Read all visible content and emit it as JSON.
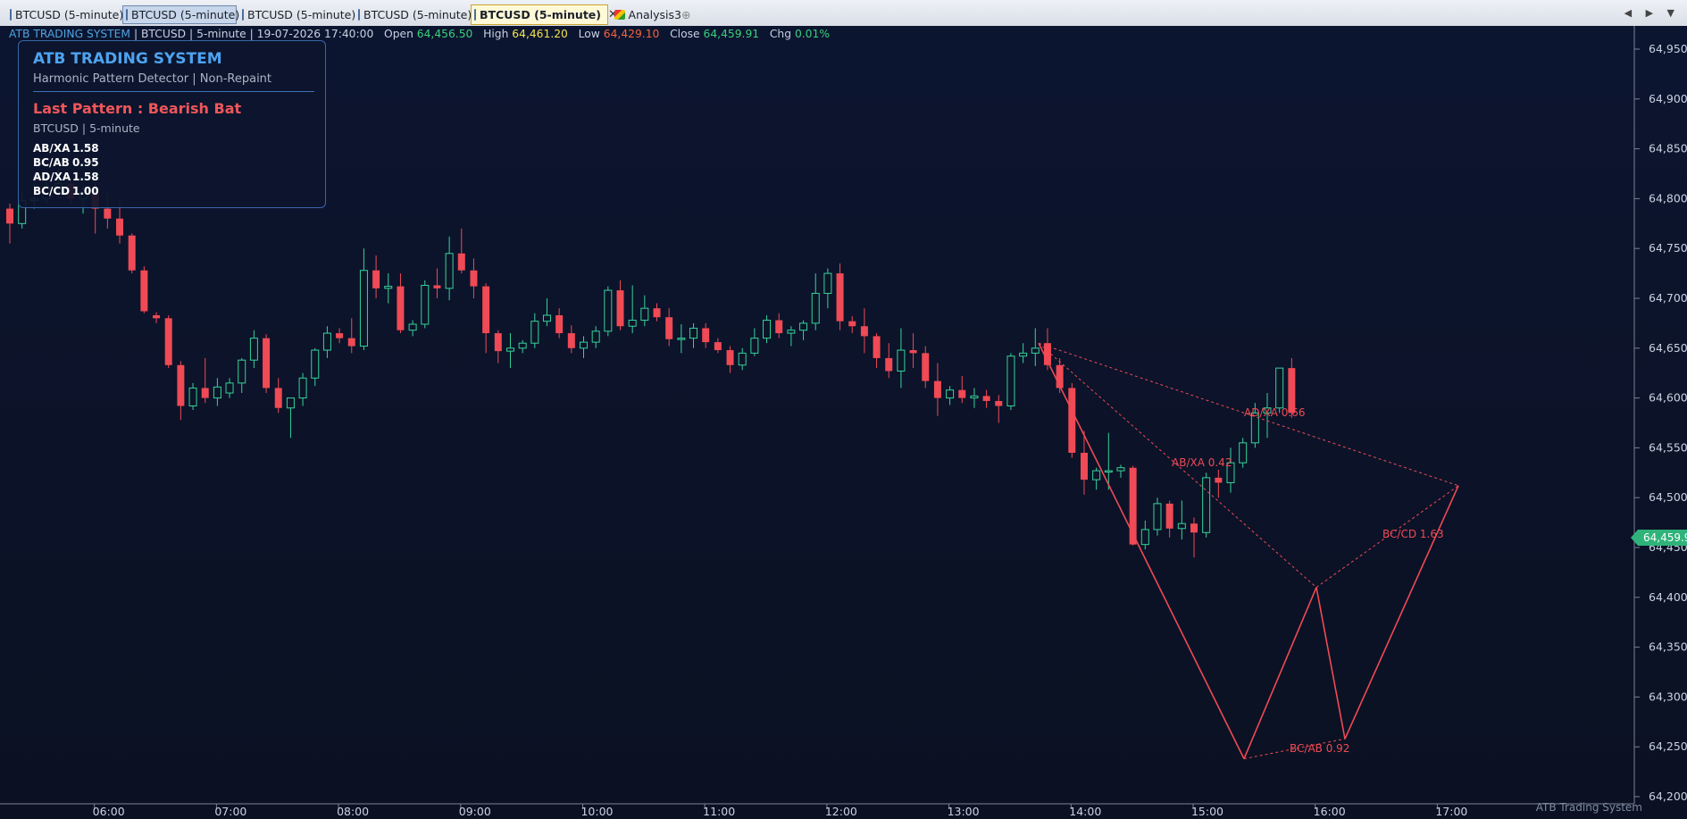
{
  "tabs": [
    {
      "label": "BTCUSD (5-minute)",
      "state": "normal"
    },
    {
      "label": "BTCUSD (5-minute)",
      "state": "selected"
    },
    {
      "label": "BTCUSD (5-minute)",
      "state": "normal"
    },
    {
      "label": "BTCUSD (5-minute)",
      "state": "normal"
    },
    {
      "label": "BTCUSD (5-minute)",
      "state": "active",
      "close": "✕"
    },
    {
      "label": "Analysis3",
      "state": "normal"
    }
  ],
  "new_tab_glyph": "⊕",
  "nav_arrows": "◀ ▶ ▼",
  "info_line": {
    "indicator": "ATB TRADING SYSTEM",
    "symbol": "BTCUSD",
    "interval": "5-minute",
    "datetime": "19-07-2026 17:40:00",
    "open_label": "Open",
    "open": "64,456.50",
    "high_label": "High",
    "high": "64,461.20",
    "low_label": "Low",
    "low": "64,429.10",
    "close_label": "Close",
    "close": "64,459.91",
    "chg_label": "Chg",
    "chg": "0.01%"
  },
  "panel": {
    "title": "ATB TRADING SYSTEM",
    "subtitle": "Harmonic Pattern Detector  |  Non-Repaint",
    "last_pattern": "Last Pattern : Bearish Bat",
    "symbol_line": "BTCUSD   |   5-minute",
    "ratios": [
      {
        "name": "AB/XA",
        "value": "1.58"
      },
      {
        "name": "BC/AB",
        "value": "0.95"
      },
      {
        "name": "AD/XA",
        "value": "1.58"
      },
      {
        "name": "BC/CD",
        "value": "1.00"
      }
    ]
  },
  "colors": {
    "background": "#0c1428",
    "bull": "#36d39a",
    "bear": "#ef4a55",
    "pattern": "#ef4a55",
    "price_tag": "#2fb37a",
    "panel_border": "#3766a8"
  },
  "chart_data": {
    "type": "candlestick",
    "y_ticks": [
      "64,950",
      "64,900",
      "64,850",
      "64,800",
      "64,750",
      "64,700",
      "64,650",
      "64,600",
      "64,550",
      "64,500",
      "64,450",
      "64,400",
      "64,350",
      "64,300",
      "64,250",
      "64,200"
    ],
    "y_tick_values": [
      64950,
      64900,
      64850,
      64800,
      64750,
      64700,
      64650,
      64600,
      64550,
      64500,
      64450,
      64400,
      64350,
      64300,
      64250,
      64200
    ],
    "x_ticks": [
      "06:00",
      "07:00",
      "08:00",
      "09:00",
      "10:00",
      "11:00",
      "12:00",
      "13:00",
      "14:00",
      "15:00",
      "16:00",
      "17:00"
    ],
    "x_tick_indices": [
      7,
      17,
      27,
      37,
      47,
      57,
      67,
      77,
      87,
      97,
      107,
      117
    ],
    "last_price": "64,459.9",
    "last_price_value": 64459.9,
    "candles_ohlc": [
      [
        64790,
        64795,
        64755,
        64775
      ],
      [
        64775,
        64808,
        64770,
        64798
      ],
      [
        64798,
        64815,
        64790,
        64800
      ],
      [
        64800,
        64825,
        64795,
        64812
      ],
      [
        64812,
        64830,
        64800,
        64815
      ],
      [
        64815,
        64820,
        64795,
        64800
      ],
      [
        64800,
        64812,
        64785,
        64805
      ],
      [
        64805,
        64815,
        64765,
        64790
      ],
      [
        64790,
        64805,
        64770,
        64780
      ],
      [
        64780,
        64800,
        64755,
        64763
      ],
      [
        64763,
        64765,
        64725,
        64728
      ],
      [
        64728,
        64732,
        64685,
        64687
      ],
      [
        64683,
        64686,
        64675,
        64680
      ],
      [
        64680,
        64683,
        64630,
        64633
      ],
      [
        64633,
        64637,
        64578,
        64592
      ],
      [
        64592,
        64615,
        64588,
        64610
      ],
      [
        64610,
        64640,
        64595,
        64600
      ],
      [
        64600,
        64620,
        64592,
        64611
      ],
      [
        64605,
        64620,
        64600,
        64615
      ],
      [
        64615,
        64640,
        64605,
        64638
      ],
      [
        64638,
        64668,
        64630,
        64660
      ],
      [
        64660,
        64664,
        64605,
        64610
      ],
      [
        64610,
        64620,
        64585,
        64590
      ],
      [
        64590,
        64598,
        64560,
        64600
      ],
      [
        64600,
        64625,
        64592,
        64620
      ],
      [
        64620,
        64650,
        64612,
        64648
      ],
      [
        64648,
        64672,
        64640,
        64665
      ],
      [
        64665,
        64670,
        64655,
        64660
      ],
      [
        64660,
        64680,
        64645,
        64652
      ],
      [
        64652,
        64750,
        64648,
        64728
      ],
      [
        64728,
        64743,
        64700,
        64710
      ],
      [
        64710,
        64725,
        64695,
        64712
      ],
      [
        64712,
        64725,
        64665,
        64668
      ],
      [
        64668,
        64678,
        64662,
        64674
      ],
      [
        64674,
        64718,
        64670,
        64713
      ],
      [
        64713,
        64730,
        64700,
        64710
      ],
      [
        64710,
        64762,
        64698,
        64745
      ],
      [
        64745,
        64770,
        64725,
        64728
      ],
      [
        64728,
        64740,
        64700,
        64712
      ],
      [
        64712,
        64715,
        64645,
        64665
      ],
      [
        64665,
        64668,
        64635,
        64647
      ],
      [
        64647,
        64665,
        64630,
        64650
      ],
      [
        64650,
        64658,
        64645,
        64655
      ],
      [
        64655,
        64685,
        64650,
        64677
      ],
      [
        64677,
        64700,
        64672,
        64683
      ],
      [
        64683,
        64690,
        64660,
        64665
      ],
      [
        64665,
        64673,
        64645,
        64650
      ],
      [
        64650,
        64662,
        64640,
        64656
      ],
      [
        64656,
        64672,
        64650,
        64667
      ],
      [
        64667,
        64712,
        64662,
        64708
      ],
      [
        64708,
        64718,
        64668,
        64672
      ],
      [
        64672,
        64713,
        64665,
        64678
      ],
      [
        64678,
        64703,
        64672,
        64690
      ],
      [
        64690,
        64695,
        64677,
        64681
      ],
      [
        64681,
        64690,
        64652,
        64659
      ],
      [
        64659,
        64674,
        64645,
        64660
      ],
      [
        64660,
        64675,
        64650,
        64670
      ],
      [
        64670,
        64675,
        64650,
        64656
      ],
      [
        64656,
        64660,
        64645,
        64648
      ],
      [
        64648,
        64652,
        64625,
        64633
      ],
      [
        64633,
        64650,
        64628,
        64645
      ],
      [
        64645,
        64670,
        64642,
        64660
      ],
      [
        64660,
        64683,
        64655,
        64678
      ],
      [
        64678,
        64685,
        64660,
        64665
      ],
      [
        64665,
        64672,
        64652,
        64668
      ],
      [
        64668,
        64678,
        64658,
        64675
      ],
      [
        64675,
        64725,
        64668,
        64705
      ],
      [
        64705,
        64730,
        64690,
        64725
      ],
      [
        64725,
        64735,
        64668,
        64677
      ],
      [
        64677,
        64682,
        64665,
        64672
      ],
      [
        64672,
        64690,
        64645,
        64662
      ],
      [
        64662,
        64665,
        64630,
        64640
      ],
      [
        64640,
        64655,
        64620,
        64627
      ],
      [
        64627,
        64670,
        64610,
        64648
      ],
      [
        64648,
        64665,
        64630,
        64645
      ],
      [
        64645,
        64652,
        64610,
        64617
      ],
      [
        64617,
        64635,
        64582,
        64600
      ],
      [
        64600,
        64612,
        64593,
        64608
      ],
      [
        64608,
        64622,
        64595,
        64600
      ],
      [
        64600,
        64610,
        64590,
        64602
      ],
      [
        64602,
        64608,
        64590,
        64597
      ],
      [
        64597,
        64603,
        64575,
        64592
      ],
      [
        64592,
        64645,
        64588,
        64642
      ],
      [
        64642,
        64655,
        64635,
        64645
      ],
      [
        64645,
        64670,
        64632,
        64650
      ],
      [
        64655,
        64670,
        64628,
        64633
      ],
      [
        64633,
        64640,
        64605,
        64610
      ],
      [
        64610,
        64615,
        64540,
        64545
      ],
      [
        64545,
        64567,
        64503,
        64518
      ],
      [
        64518,
        64530,
        64508,
        64527
      ],
      [
        64527,
        64565,
        64508,
        64527
      ],
      [
        64527,
        64533,
        64520,
        64530
      ],
      [
        64530,
        64532,
        64452,
        64453
      ],
      [
        64453,
        64477,
        64448,
        64468
      ],
      [
        64468,
        64500,
        64462,
        64494
      ],
      [
        64494,
        64497,
        64460,
        64469
      ],
      [
        64469,
        64497,
        64458,
        64474
      ],
      [
        64474,
        64480,
        64440,
        64465
      ],
      [
        64465,
        64525,
        64460,
        64520
      ],
      [
        64520,
        64528,
        64500,
        64515
      ],
      [
        64515,
        64550,
        64505,
        64535
      ],
      [
        64535,
        64560,
        64530,
        64555
      ],
      [
        64555,
        64595,
        64550,
        64585
      ],
      [
        64585,
        64605,
        64560,
        64590
      ],
      [
        64590,
        64620,
        64585,
        64630
      ],
      [
        64630,
        64640,
        64580,
        64585
      ]
    ],
    "pattern": {
      "name": "Bearish Bat",
      "points": {
        "X": [
          64655
        ],
        "A": [
          64238
        ],
        "B": [
          64410
        ],
        "C": [
          64258
        ],
        "D": [
          64512
        ]
      },
      "labels": [
        {
          "text": "AD/XA  0.66"
        },
        {
          "text": "AB/XA  0.42"
        },
        {
          "text": "BC/CD  1.63"
        },
        {
          "text": "BC/AB  0.92"
        }
      ]
    }
  },
  "watermark": "ATB Trading System"
}
